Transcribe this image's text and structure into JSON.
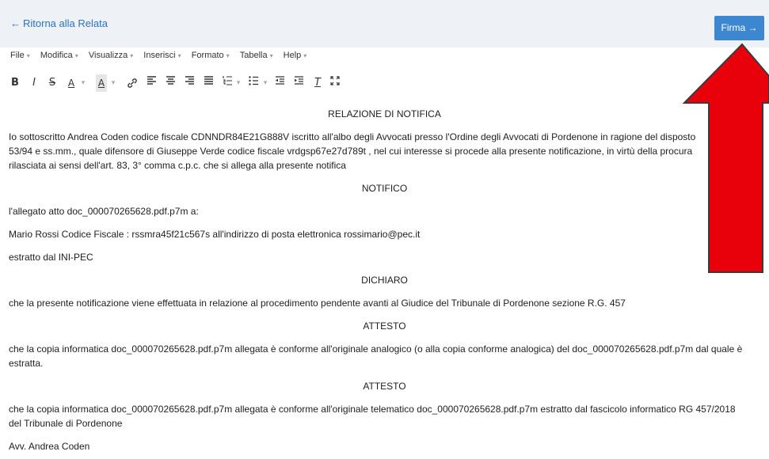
{
  "header": {
    "back_label": "Ritorna alla Relata",
    "firma_label": "Firma"
  },
  "menubar": {
    "items": [
      "File",
      "Modifica",
      "Visualizza",
      "Inserisci",
      "Formato",
      "Tabella",
      "Help"
    ]
  },
  "toolbar": {
    "bold": "B",
    "italic": "I",
    "strike": "S",
    "font_color": "A",
    "bg_color": "A",
    "clear_format": "T"
  },
  "document": {
    "title": "RELAZIONE DI NOTIFICA",
    "intro_line1": "Io sottoscritto Andrea Coden codice fiscale CDNNDR84E21G888V iscritto all'albo degli Avvocati presso l'Ordine degli Avvocati di Pordenone in ragione del disposto",
    "intro_line2": "53/94 e ss.mm., quale difensore di Giuseppe Verde codice fiscale vrdgsp67e27d789t , nel cui interesse si procede alla presente notificazione, in virtù della procura",
    "intro_line3": "rilasciata ai sensi dell'art. 83, 3° comma c.p.c. che si allega alla presente notifica",
    "notifico": "NOTIFICO",
    "allegato": "l'allegato atto doc_000070265628.pdf.p7m a:",
    "destinatario": "Mario Rossi Codice Fiscale : rssmra45f21c567s all'indirizzo di posta elettronica rossimario@pec.it",
    "estratto": "estratto dal INI-PEC",
    "dichiaro": "DICHIARO",
    "dichiaro_text": "che la presente notificazione viene effettuata in relazione al procedimento pendente avanti al Giudice del Tribunale di Pordenone sezione R.G. 457",
    "attesto1": "ATTESTO",
    "attesto1_line1": "che la copia informatica doc_000070265628.pdf.p7m allegata è conforme all'originale analogico (o alla copia conforme analogica) del doc_000070265628.pdf.p7m dal quale è",
    "attesto1_line2": "estratta.",
    "attesto2": "ATTESTO",
    "attesto2_line1": "che la copia informatica doc_000070265628.pdf.p7m allegata è conforme all'originale telematico doc_000070265628.pdf.p7m estratto dal fascicolo informatico RG 457/2018",
    "attesto2_line2": "del Tribunale di Pordenone",
    "signature": "Avv. Andrea Coden"
  },
  "colors": {
    "accent": "#3d87d0",
    "link": "#2a72c3",
    "arrow": "#e8000b"
  }
}
